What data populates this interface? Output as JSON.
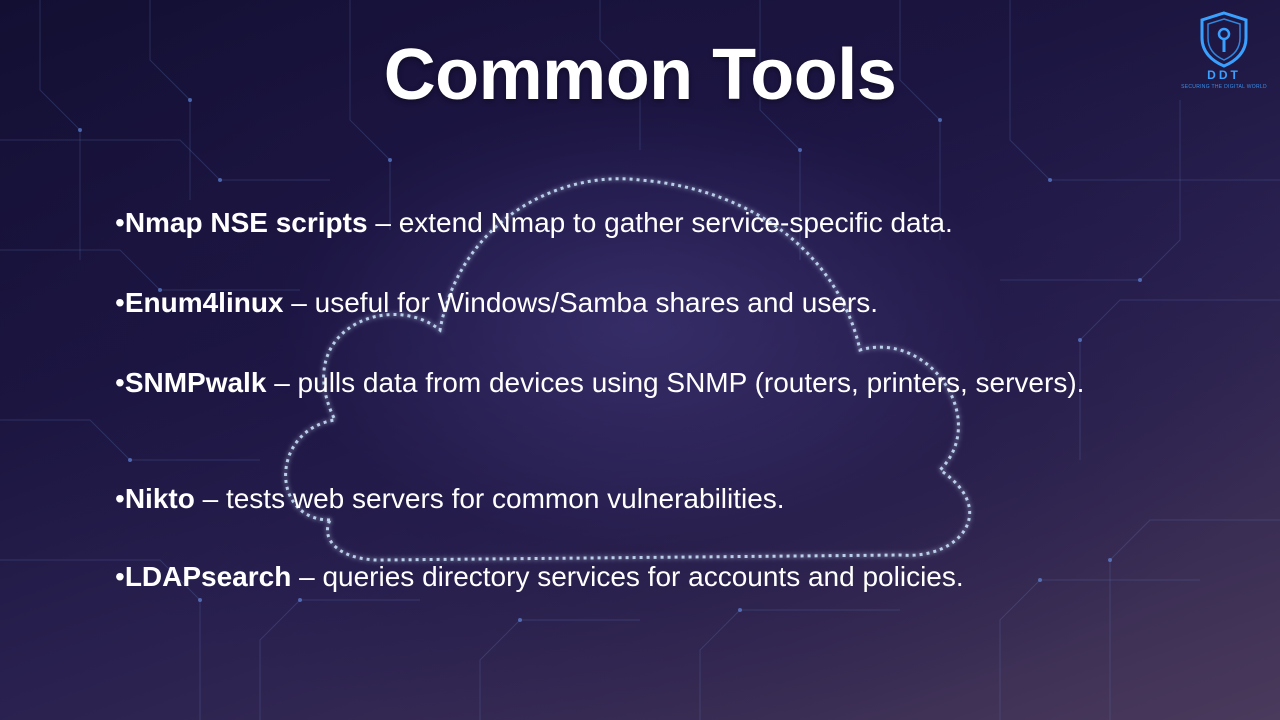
{
  "slide": {
    "title": "Common Tools",
    "bullets": [
      {
        "marker": "•",
        "term": "Nmap NSE scripts",
        "desc": " – extend Nmap to gather service-specific data."
      },
      {
        "marker": "•",
        "term": "Enum4linux",
        "desc": " – useful for Windows/Samba shares and users."
      },
      {
        "marker": "•",
        "term": "SNMPwalk",
        "desc": " – pulls data from devices using SNMP (routers, printers, servers)."
      },
      {
        "marker": "•",
        "term": "Nikto",
        "desc": " – tests web servers for common vulnerabilities."
      },
      {
        "marker": "•",
        "term": "LDAPsearch",
        "desc": " – queries directory services for accounts and policies."
      }
    ]
  },
  "logo": {
    "name": "DDT",
    "tagline": "SECURING THE DIGITAL WORLD",
    "icon": "shield-keyhole-icon",
    "color": "#3aa0ff"
  },
  "background": {
    "icon": "cloud-outline-icon",
    "accent": "#bfe3ff"
  }
}
